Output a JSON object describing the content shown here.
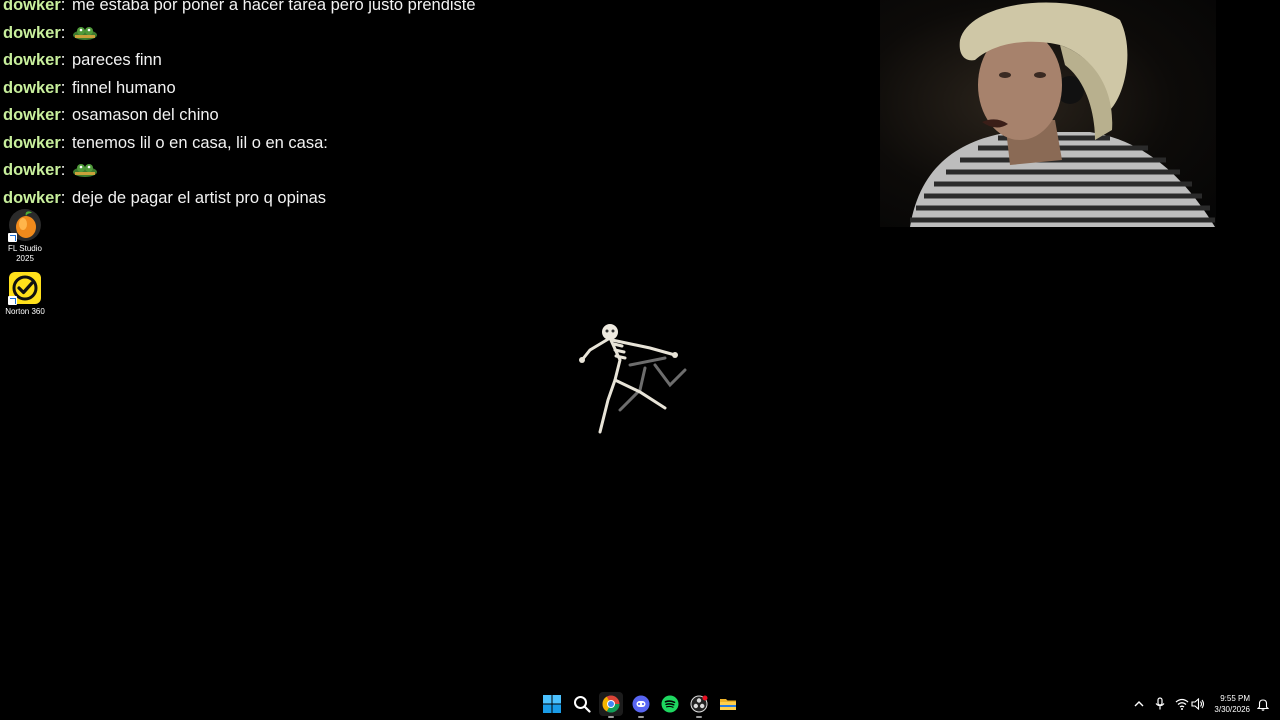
{
  "chat": {
    "messages": [
      {
        "user": "dowker",
        "text": "me estaba por poner a hacer tarea pero justo prendiste",
        "emote": ""
      },
      {
        "user": "dowker",
        "text": "",
        "emote": "emote"
      },
      {
        "user": "dowker",
        "text": "pareces finn",
        "emote": ""
      },
      {
        "user": "dowker",
        "text": "finnel humano",
        "emote": ""
      },
      {
        "user": "dowker",
        "text": "osamason del chino",
        "emote": ""
      },
      {
        "user": "dowker",
        "text": "tenemos lil o en casa, lil o en casa:",
        "emote": ""
      },
      {
        "user": "dowker",
        "text": "",
        "emote": "emote"
      },
      {
        "user": "dowker",
        "text": "deje de pagar el artist pro q opinas",
        "emote": ""
      }
    ],
    "separator": ":"
  },
  "desktop": {
    "icons": [
      {
        "label_line1": "FL Studio",
        "label_line2": "2025",
        "icon": "fl-studio-icon"
      },
      {
        "label_line1": "Norton 360",
        "label_line2": "",
        "icon": "norton-icon"
      }
    ]
  },
  "taskbar": {
    "apps": [
      "windows-start-icon",
      "search-icon",
      "chrome-icon",
      "discord-icon",
      "spotify-icon",
      "obs-icon",
      "file-explorer-icon"
    ],
    "tray": [
      "chevron-up-icon",
      "microphone-icon",
      "wifi-icon",
      "volume-icon"
    ],
    "time": "9:55 PM",
    "date": "3/30/2026"
  },
  "colors": {
    "username": "#c8ef9c",
    "background": "#000000",
    "norton_yellow": "#ffe01b",
    "spotify_green": "#1ed760",
    "discord_blurple": "#5865f2"
  }
}
